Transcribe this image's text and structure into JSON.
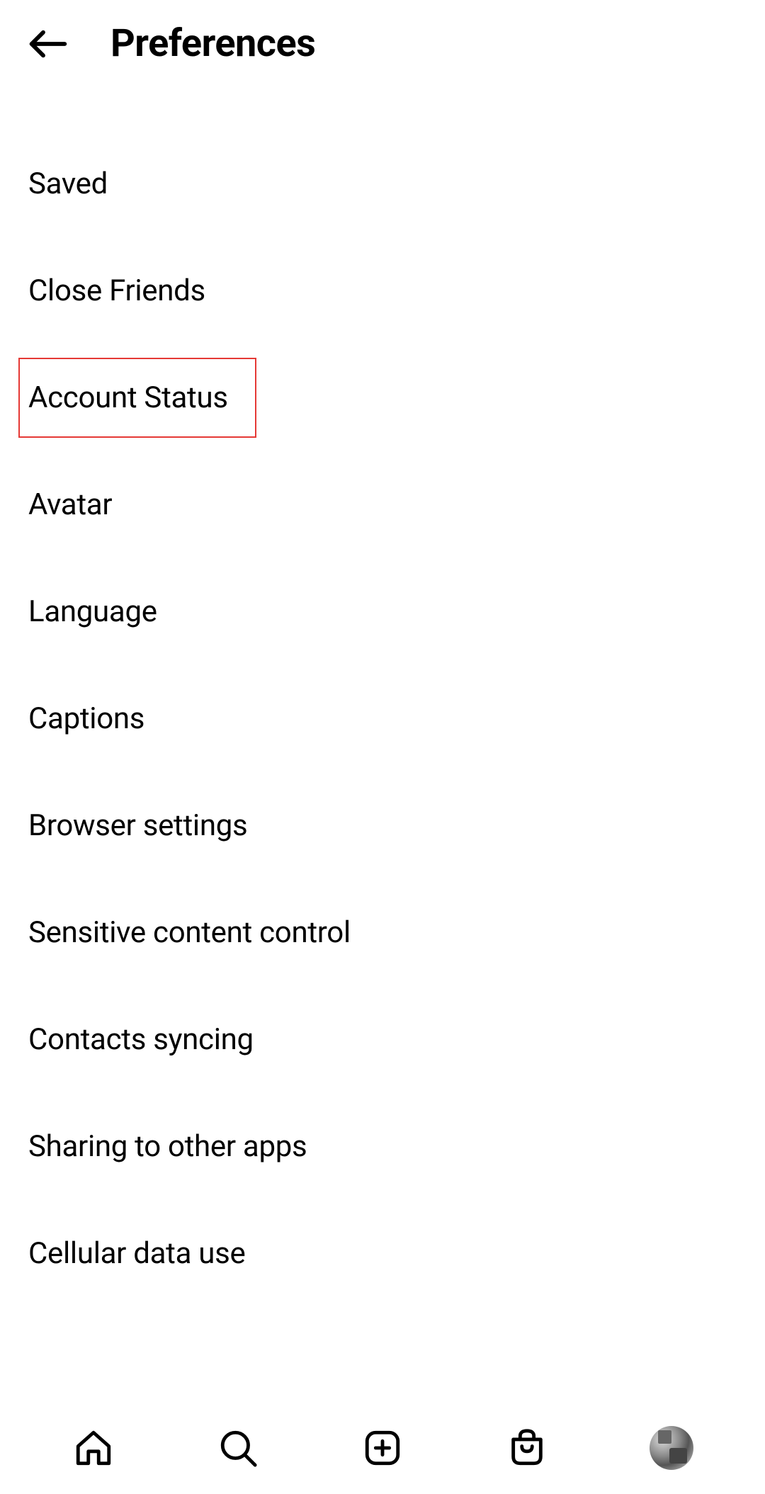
{
  "header": {
    "title": "Preferences"
  },
  "menu": {
    "items": [
      {
        "label": "Saved",
        "highlighted": false
      },
      {
        "label": "Close Friends",
        "highlighted": false
      },
      {
        "label": "Account Status",
        "highlighted": true
      },
      {
        "label": "Avatar",
        "highlighted": false
      },
      {
        "label": "Language",
        "highlighted": false
      },
      {
        "label": "Captions",
        "highlighted": false
      },
      {
        "label": "Browser settings",
        "highlighted": false
      },
      {
        "label": "Sensitive content control",
        "highlighted": false
      },
      {
        "label": "Contacts syncing",
        "highlighted": false
      },
      {
        "label": "Sharing to other apps",
        "highlighted": false
      },
      {
        "label": "Cellular data use",
        "highlighted": false
      }
    ]
  },
  "nav": {
    "items": [
      "home",
      "search",
      "create",
      "shop",
      "profile"
    ]
  }
}
